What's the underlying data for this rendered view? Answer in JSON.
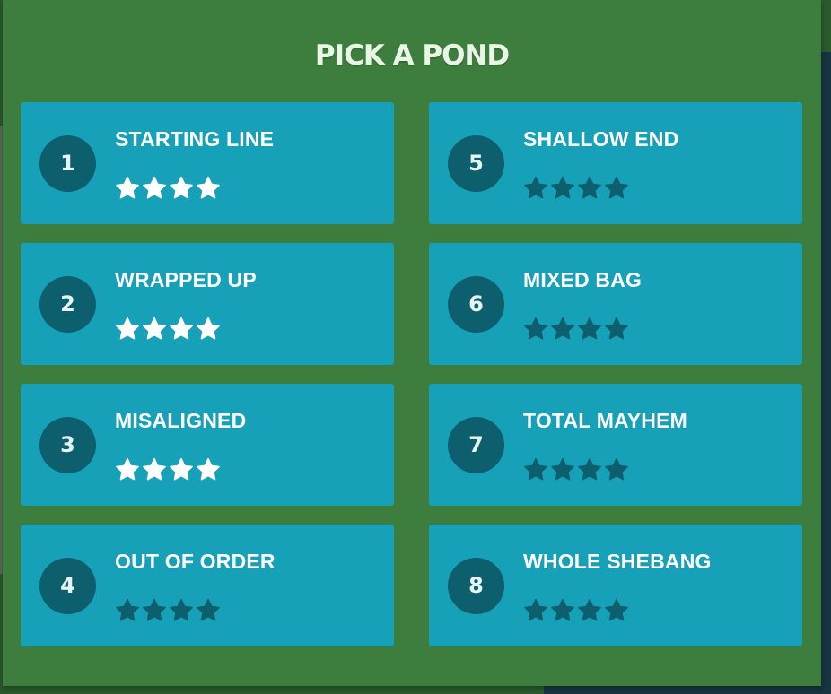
{
  "title": "PICK A POND",
  "colors": {
    "star_earned": "#ffffff",
    "star_unearned": "#0d5f6e"
  },
  "levels": [
    {
      "number": "1",
      "name": "STARTING LINE",
      "stars_earned": 4,
      "stars_total": 4
    },
    {
      "number": "5",
      "name": "SHALLOW END",
      "stars_earned": 0,
      "stars_total": 4
    },
    {
      "number": "2",
      "name": "WRAPPED UP",
      "stars_earned": 4,
      "stars_total": 4
    },
    {
      "number": "6",
      "name": "MIXED BAG",
      "stars_earned": 0,
      "stars_total": 4
    },
    {
      "number": "3",
      "name": "MISALIGNED",
      "stars_earned": 4,
      "stars_total": 4
    },
    {
      "number": "7",
      "name": "TOTAL MAYHEM",
      "stars_earned": 0,
      "stars_total": 4
    },
    {
      "number": "4",
      "name": "OUT OF ORDER",
      "stars_earned": 0,
      "stars_total": 4
    },
    {
      "number": "8",
      "name": "WHOLE SHEBANG",
      "stars_earned": 0,
      "stars_total": 4
    }
  ]
}
